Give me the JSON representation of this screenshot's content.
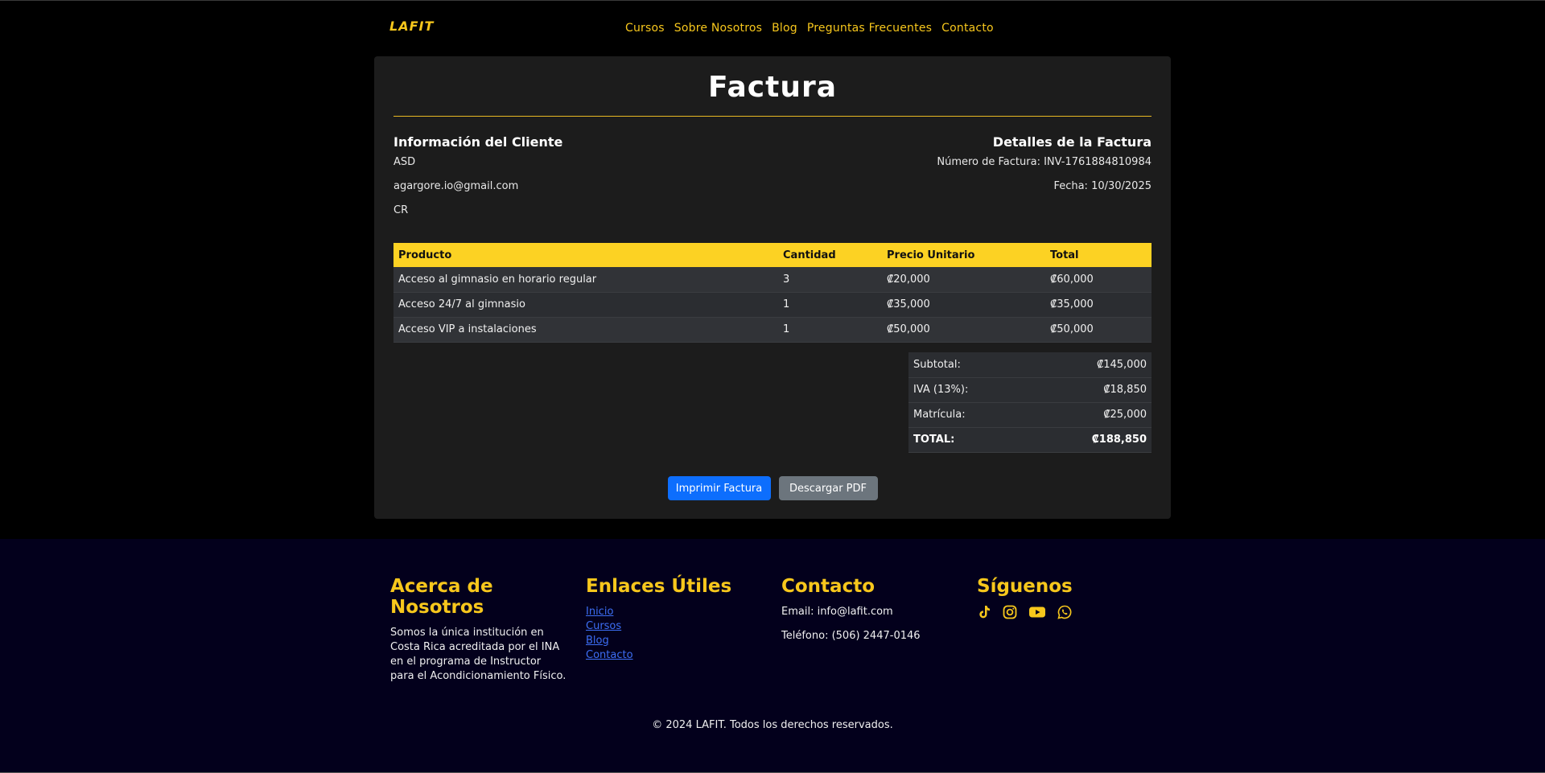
{
  "brand": {
    "logo_text": "LAFIT",
    "accent": "#f7c71c"
  },
  "nav": {
    "items": [
      {
        "label": "Cursos"
      },
      {
        "label": "Sobre Nosotros"
      },
      {
        "label": "Blog"
      },
      {
        "label": "Preguntas Frecuentes"
      },
      {
        "label": "Contacto"
      }
    ]
  },
  "invoice": {
    "title": "Factura",
    "client": {
      "heading": "Información del Cliente",
      "name": "ASD",
      "email": "agargore.io@gmail.com",
      "country": "CR"
    },
    "details": {
      "heading": "Detalles de la Factura",
      "number_label": "Número de Factura: INV-1761884810984",
      "date_label": "Fecha: 10/30/2025"
    },
    "table": {
      "headers": [
        "Producto",
        "Cantidad",
        "Precio Unitario",
        "Total"
      ],
      "rows": [
        {
          "product": "Acceso al gimnasio en horario regular",
          "qty": "3",
          "unit": "₡20,000",
          "total": "₡60,000"
        },
        {
          "product": "Acceso 24/7 al gimnasio",
          "qty": "1",
          "unit": "₡35,000",
          "total": "₡35,000"
        },
        {
          "product": "Acceso VIP a instalaciones",
          "qty": "1",
          "unit": "₡50,000",
          "total": "₡50,000"
        }
      ]
    },
    "totals": {
      "subtotal_label": "Subtotal:",
      "subtotal": "₡145,000",
      "iva_label": "IVA (13%):",
      "iva": "₡18,850",
      "matricula_label": "Matrícula:",
      "matricula": "₡25,000",
      "total_label": "TOTAL:",
      "total": "₡188,850"
    },
    "buttons": {
      "print": "Imprimir Factura",
      "download": "Descargar PDF"
    }
  },
  "footer": {
    "about": {
      "heading": "Acerca de Nosotros",
      "text": "Somos la única institución en Costa Rica acreditada por el INA en el programa de Instructor para el Acondicionamiento Físico."
    },
    "links": {
      "heading": "Enlaces Útiles",
      "items": [
        "Inicio",
        "Cursos",
        "Blog",
        "Contacto"
      ]
    },
    "contact": {
      "heading": "Contacto",
      "email": "Email: info@lafit.com",
      "phone": "Teléfono: (506) 2447-0146"
    },
    "social": {
      "heading": "Síguenos",
      "icons": [
        "tiktok-icon",
        "instagram-icon",
        "youtube-icon",
        "whatsapp-icon"
      ]
    },
    "copyright": "© 2024 LAFIT. Todos los derechos reservados."
  }
}
